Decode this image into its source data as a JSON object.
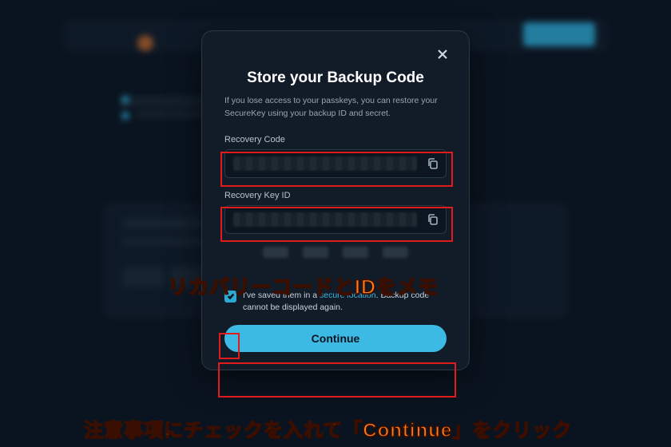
{
  "modal": {
    "title": "Store your Backup Code",
    "description": "If you lose access to your passkeys, you can restore your SecureKey using your backup ID and secret.",
    "fields": {
      "recovery_code": {
        "label": "Recovery Code"
      },
      "recovery_key_id": {
        "label": "Recovery Key ID"
      }
    },
    "confirm": {
      "text_prefix": "I've saved them in a ",
      "link_text": "secure location",
      "text_suffix": ". Backup code cannot be displayed again.",
      "checked": true
    },
    "continue_label": "Continue"
  },
  "annotations": {
    "line1": "リカバリーコードとIDをメモ",
    "line2": "注意事項にチェックを入れて「Continue」をクリック"
  },
  "colors": {
    "accent": "#3dbae4",
    "highlight_box": "#e11b1b",
    "annotation_text": "#ff7d1a"
  }
}
